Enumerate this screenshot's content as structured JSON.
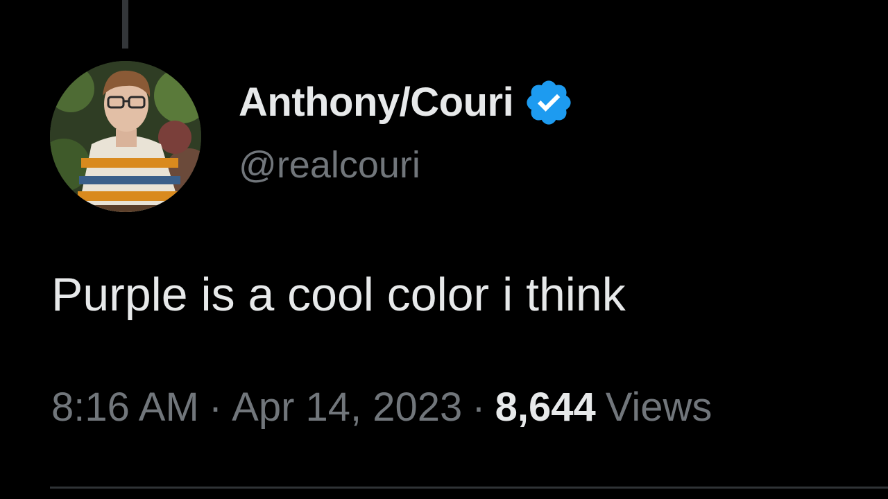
{
  "tweet": {
    "display_name": "Anthony/Couri",
    "handle": "@realcouri",
    "verified_icon": "verified-badge-icon",
    "text": "Purple is a cool color i think",
    "time": "8:16 AM",
    "separator": "·",
    "date": "Apr 14, 2023",
    "views_count": "8,644",
    "views_label": "Views"
  },
  "colors": {
    "background": "#000000",
    "primary_text": "#e7e9ea",
    "secondary_text": "#71767b",
    "verified_blue": "#1d9bf0",
    "divider": "#2f3336"
  }
}
